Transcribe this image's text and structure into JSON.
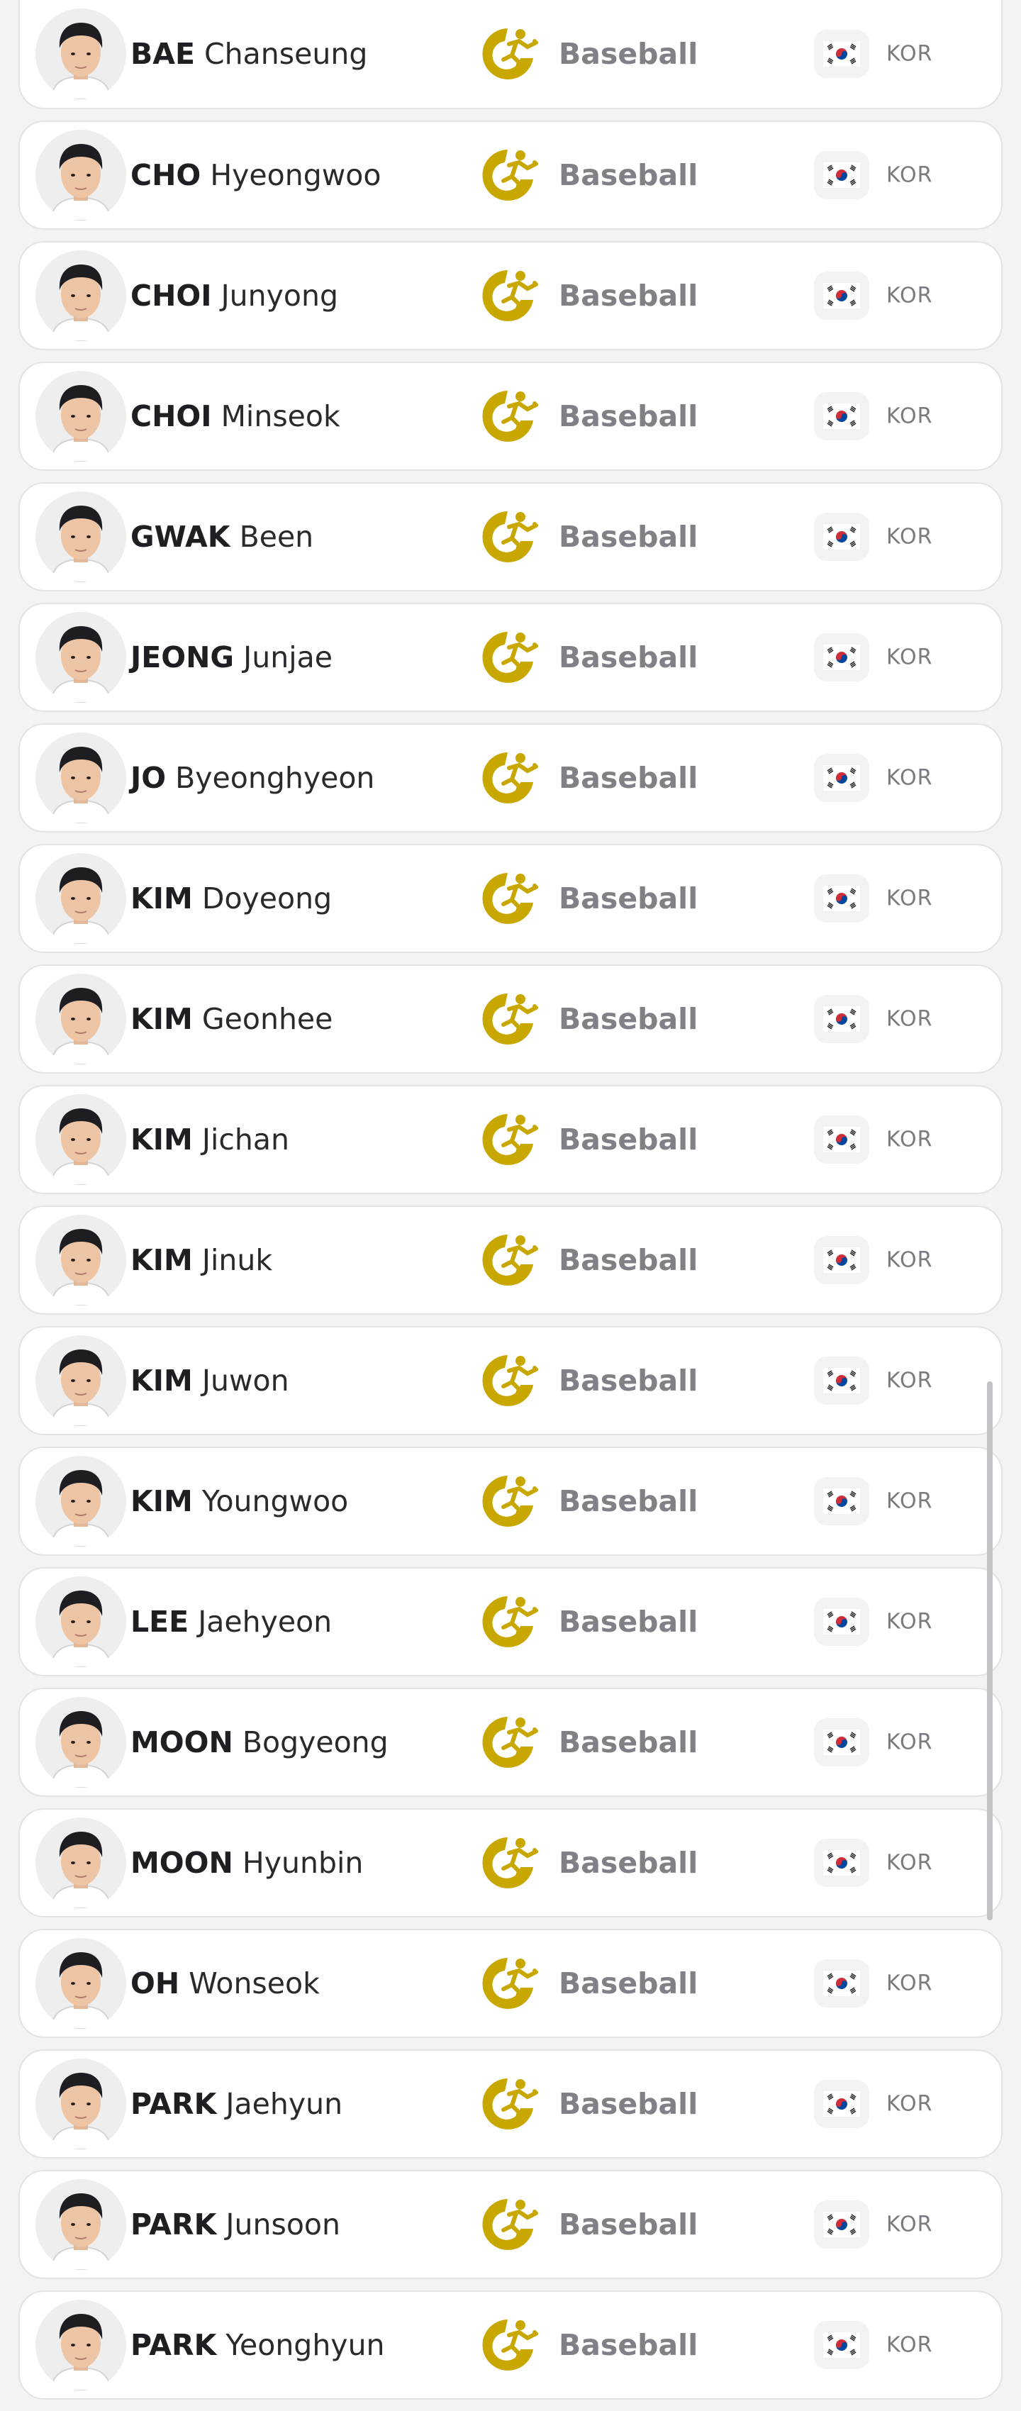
{
  "colors": {
    "sport_icon": "#c8a800",
    "sport_text": "#808086",
    "name_text": "#2a2a2e",
    "card_border": "#e3e3e6",
    "background": "#f3f3f5"
  },
  "athletes": [
    {
      "last": "BAE",
      "first": "Chanseung",
      "sport": "Baseball",
      "country": "KOR",
      "sport_icon": "baseball-icon",
      "flag_icon": "korea-flag-icon"
    },
    {
      "last": "CHO",
      "first": "Hyeongwoo",
      "sport": "Baseball",
      "country": "KOR",
      "sport_icon": "baseball-icon",
      "flag_icon": "korea-flag-icon"
    },
    {
      "last": "CHOI",
      "first": "Junyong",
      "sport": "Baseball",
      "country": "KOR",
      "sport_icon": "baseball-icon",
      "flag_icon": "korea-flag-icon"
    },
    {
      "last": "CHOI",
      "first": "Minseok",
      "sport": "Baseball",
      "country": "KOR",
      "sport_icon": "baseball-icon",
      "flag_icon": "korea-flag-icon"
    },
    {
      "last": "GWAK",
      "first": "Been",
      "sport": "Baseball",
      "country": "KOR",
      "sport_icon": "baseball-icon",
      "flag_icon": "korea-flag-icon"
    },
    {
      "last": "JEONG",
      "first": "Junjae",
      "sport": "Baseball",
      "country": "KOR",
      "sport_icon": "baseball-icon",
      "flag_icon": "korea-flag-icon"
    },
    {
      "last": "JO",
      "first": "Byeonghyeon",
      "sport": "Baseball",
      "country": "KOR",
      "sport_icon": "baseball-icon",
      "flag_icon": "korea-flag-icon"
    },
    {
      "last": "KIM",
      "first": "Doyeong",
      "sport": "Baseball",
      "country": "KOR",
      "sport_icon": "baseball-icon",
      "flag_icon": "korea-flag-icon"
    },
    {
      "last": "KIM",
      "first": "Geonhee",
      "sport": "Baseball",
      "country": "KOR",
      "sport_icon": "baseball-icon",
      "flag_icon": "korea-flag-icon"
    },
    {
      "last": "KIM",
      "first": "Jichan",
      "sport": "Baseball",
      "country": "KOR",
      "sport_icon": "baseball-icon",
      "flag_icon": "korea-flag-icon"
    },
    {
      "last": "KIM",
      "first": "Jinuk",
      "sport": "Baseball",
      "country": "KOR",
      "sport_icon": "baseball-icon",
      "flag_icon": "korea-flag-icon"
    },
    {
      "last": "KIM",
      "first": "Juwon",
      "sport": "Baseball",
      "country": "KOR",
      "sport_icon": "baseball-icon",
      "flag_icon": "korea-flag-icon"
    },
    {
      "last": "KIM",
      "first": "Youngwoo",
      "sport": "Baseball",
      "country": "KOR",
      "sport_icon": "baseball-icon",
      "flag_icon": "korea-flag-icon"
    },
    {
      "last": "LEE",
      "first": "Jaehyeon",
      "sport": "Baseball",
      "country": "KOR",
      "sport_icon": "baseball-icon",
      "flag_icon": "korea-flag-icon"
    },
    {
      "last": "MOON",
      "first": "Bogyeong",
      "sport": "Baseball",
      "country": "KOR",
      "sport_icon": "baseball-icon",
      "flag_icon": "korea-flag-icon"
    },
    {
      "last": "MOON",
      "first": "Hyunbin",
      "sport": "Baseball",
      "country": "KOR",
      "sport_icon": "baseball-icon",
      "flag_icon": "korea-flag-icon"
    },
    {
      "last": "OH",
      "first": "Wonseok",
      "sport": "Baseball",
      "country": "KOR",
      "sport_icon": "baseball-icon",
      "flag_icon": "korea-flag-icon"
    },
    {
      "last": "PARK",
      "first": "Jaehyun",
      "sport": "Baseball",
      "country": "KOR",
      "sport_icon": "baseball-icon",
      "flag_icon": "korea-flag-icon"
    },
    {
      "last": "PARK",
      "first": "Junsoon",
      "sport": "Baseball",
      "country": "KOR",
      "sport_icon": "baseball-icon",
      "flag_icon": "korea-flag-icon"
    },
    {
      "last": "PARK",
      "first": "Yeonghyun",
      "sport": "Baseball",
      "country": "KOR",
      "sport_icon": "baseball-icon",
      "flag_icon": "korea-flag-icon"
    }
  ]
}
